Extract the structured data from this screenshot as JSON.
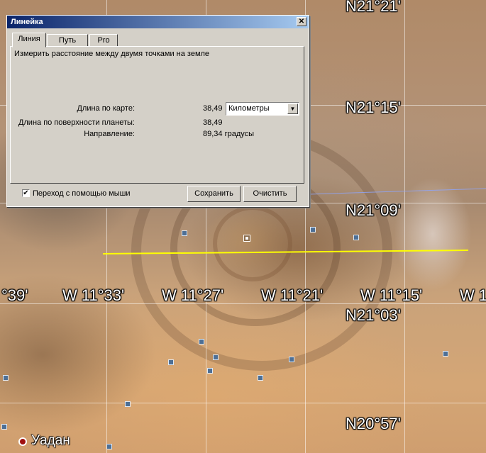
{
  "map": {
    "latitude_labels": [
      "N21°21'",
      "N21°15'",
      "N21°09'",
      "N21°03'",
      "N20°57'"
    ],
    "longitude_labels": [
      "°39'",
      "W 11°33'",
      "W 11°27'",
      "W 11°21'",
      "W 11°15'",
      "W 1"
    ],
    "place_name": "Уадан",
    "ruler_line_color": "#ffff00"
  },
  "dialog": {
    "title": "Линейка",
    "tabs": [
      "Линия",
      "Путь",
      "Pro"
    ],
    "active_tab": "Линия",
    "description": "Измерить расстояние между двумя точками на земле",
    "map_length_label": "Длина по карте:",
    "map_length_value": "38,49",
    "unit_selected": "Километры",
    "surface_length_label": "Длина по поверхности планеты:",
    "surface_length_value": "38,49",
    "direction_label": "Направление:",
    "direction_value": "89,34 градусы",
    "mouse_nav_label": "Переход с помощью мыши",
    "mouse_nav_checked": true,
    "save_label": "Сохранить",
    "clear_label": "Очистить"
  }
}
